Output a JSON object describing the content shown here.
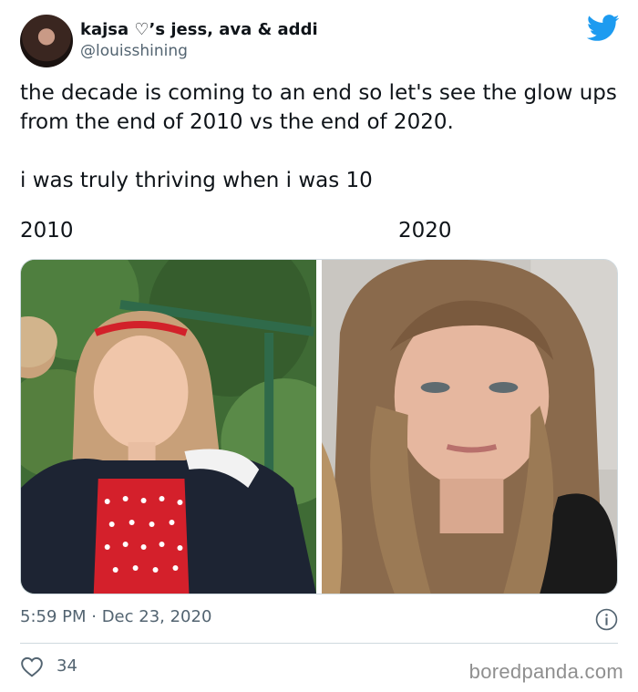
{
  "author": {
    "display_name": "kajsa ♡’s jess, ava & addi",
    "handle": "@louisshining",
    "avatar_icon": "profile-avatar"
  },
  "platform_icon": "twitter-bird-icon",
  "brand_color": "#1d9bf0",
  "tweet": {
    "text": "the decade is coming to an end so let's see the glow ups from the end of 2010 vs the end of 2020.\n\ni was truly thriving when i was 10",
    "labels": [
      "2010",
      "2020"
    ],
    "timestamp": "5:59 PM · Dec 23, 2020",
    "likes": "34"
  },
  "watermark": "boredpanda.com"
}
